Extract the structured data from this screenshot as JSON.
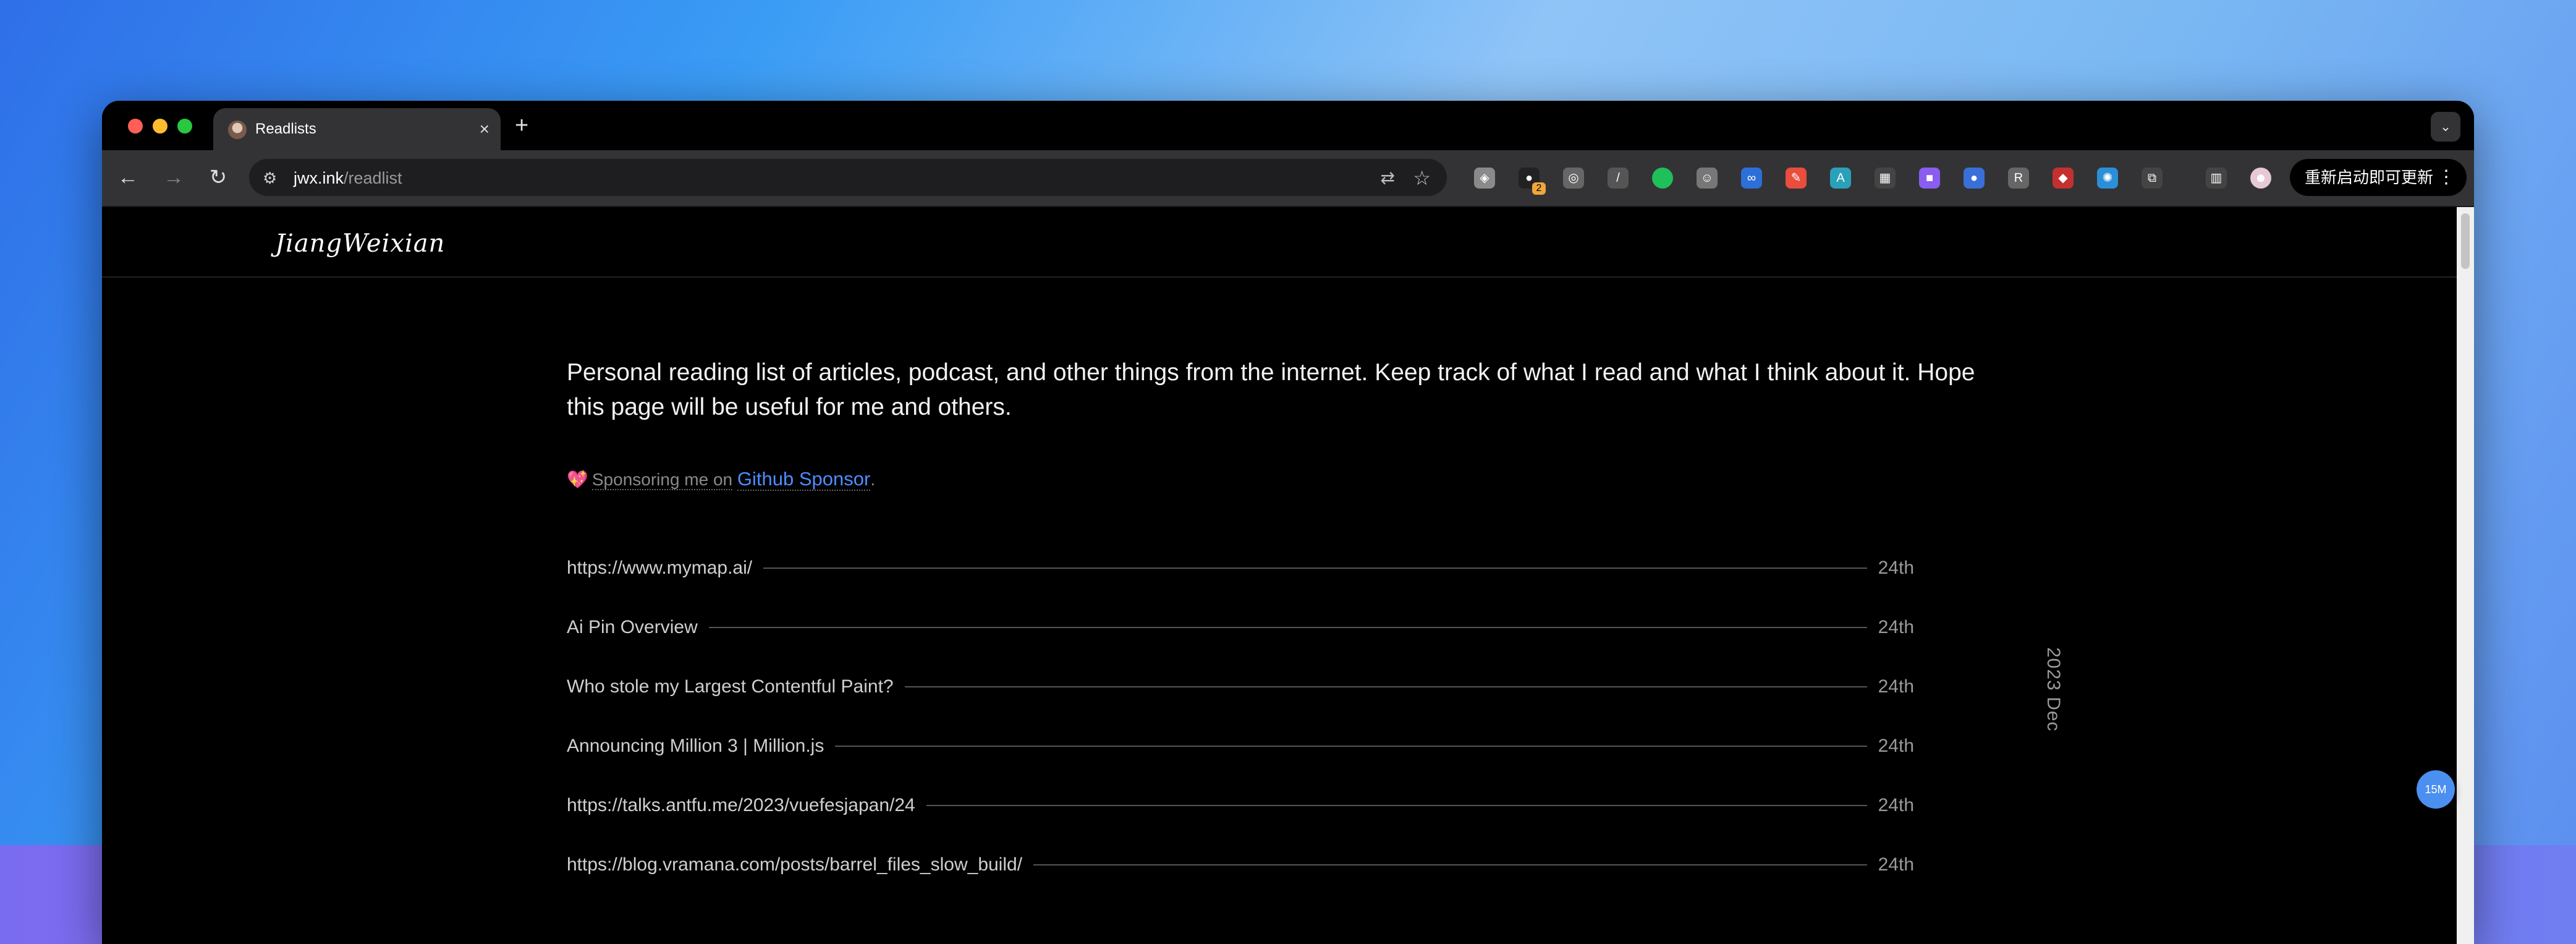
{
  "browser": {
    "tab_title": "Readlists",
    "tab_close": "×",
    "new_tab": "+",
    "url_host": "jwx.ink",
    "url_path": "/readlist",
    "restart_label": "重新启动即可更新",
    "restart_menu": "⋮",
    "extensions": [
      {
        "name": "shield-ext-icon",
        "color": "#8a8a8a",
        "glyph": "◈"
      },
      {
        "name": "notification-ext-icon",
        "color": "#222",
        "glyph": "●",
        "badge": "2"
      },
      {
        "name": "chat-ext-icon",
        "color": "#666",
        "glyph": "◎"
      },
      {
        "name": "pen-ext-icon",
        "color": "#555",
        "glyph": "/"
      },
      {
        "name": "green-dot-ext-icon",
        "color": "#1fbf5a",
        "glyph": ""
      },
      {
        "name": "face-ext-icon",
        "color": "#777",
        "glyph": "☺"
      },
      {
        "name": "link-ext-icon",
        "color": "#2d6fd8",
        "glyph": "∞"
      },
      {
        "name": "color-ext-icon",
        "color": "#e84d3d",
        "glyph": "✎"
      },
      {
        "name": "translate-ext-icon",
        "color": "#2aa1b8",
        "glyph": "A"
      },
      {
        "name": "grid-ext-icon",
        "color": "#444",
        "glyph": "▦"
      },
      {
        "name": "purple-ext-icon",
        "color": "#8a5cf0",
        "glyph": "■"
      },
      {
        "name": "user-ext-icon",
        "color": "#3a6fd8",
        "glyph": "●"
      },
      {
        "name": "r-ext-icon",
        "color": "#666",
        "glyph": "R"
      },
      {
        "name": "red-ext-icon",
        "color": "#c43030",
        "glyph": "◆"
      },
      {
        "name": "react-ext-icon",
        "color": "#2b8fd8",
        "glyph": "✺"
      },
      {
        "name": "puzzle-ext-icon",
        "color": "#444",
        "glyph": "⧉"
      },
      {
        "name": "sidepanel-icon",
        "color": "#444",
        "glyph": "▥"
      },
      {
        "name": "profile-avatar",
        "color": "#e7c9d6",
        "glyph": "☻"
      }
    ]
  },
  "site": {
    "logo_text": "JiangWeixian",
    "intro": "Personal reading list of articles, podcast, and other things from the internet. Keep track of what I read and what I think about it. Hope this page will be useful for me and others.",
    "sponsor_heart": "💖",
    "sponsor_label": "Sponsoring me on",
    "sponsor_link": "Github Sponsor",
    "sponsor_tail": ".",
    "month_label": "2023 Dec",
    "fab_label": "15M"
  },
  "readlist": [
    {
      "title": "https://www.mymap.ai/",
      "date": "24th"
    },
    {
      "title": "Ai Pin Overview",
      "date": "24th"
    },
    {
      "title": "Who stole my Largest Contentful Paint?",
      "date": "24th"
    },
    {
      "title": "Announcing Million 3 | Million.js",
      "date": "24th"
    },
    {
      "title": "https://talks.antfu.me/2023/vuefesjapan/24",
      "date": "24th"
    },
    {
      "title": "https://blog.vramana.com/posts/barrel_files_slow_build/",
      "date": "24th"
    }
  ]
}
